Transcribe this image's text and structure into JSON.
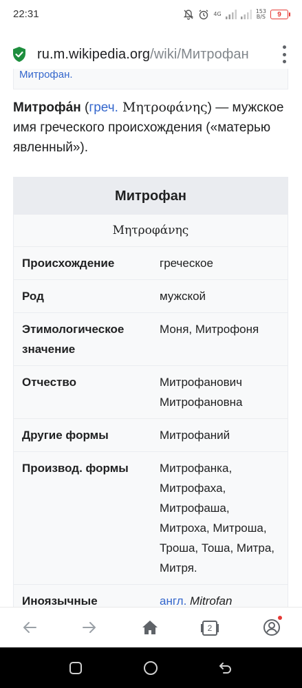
{
  "status_bar": {
    "time": "22:31",
    "network": "4G",
    "speed_value": "153",
    "speed_unit": "B/S",
    "battery": "9"
  },
  "address_bar": {
    "domain": "ru.m.wikipedia.org",
    "path": "/wiki/Митрофан",
    "lock_icon": "secure-lock-icon",
    "menu_icon": "more-vert-icon"
  },
  "article": {
    "prev_link": "Митрофан.",
    "intro": {
      "name": "Митрофа́н",
      "open_paren": " (",
      "lang_link": "греч.",
      "greek": " Μητροφάνης",
      "rest": ") — мужское имя греческого происхождения («матерью явленный»)."
    },
    "infobox": {
      "title": "Митрофан",
      "subtitle": "Μητροφάνης",
      "rows": [
        {
          "label": "Происхождение",
          "values": [
            "греческое"
          ]
        },
        {
          "label": "Род",
          "values": [
            "мужской"
          ]
        },
        {
          "label": "Этимологическое значение",
          "values": [
            "Моня, Митрофоня"
          ]
        },
        {
          "label": "Отчество",
          "values": [
            "Митрофанович",
            "Митрофановна"
          ]
        },
        {
          "label": "Другие формы",
          "values": [
            "Митрофаний"
          ]
        },
        {
          "label": "Производ. формы",
          "values": [
            "Митрофанка, Митрофаха, Митрофаша, Митроха, Митроша, Троша, Тоша, Митра, Митря."
          ]
        },
        {
          "label": "Иноязычные",
          "link": "англ.",
          "italic": "Mitrofan"
        }
      ]
    }
  },
  "bottom_nav": {
    "tab_count": "2",
    "icons": [
      "back-arrow-icon",
      "forward-arrow-icon",
      "home-icon",
      "tabs-icon",
      "account-icon"
    ]
  },
  "system_nav": {
    "icons": [
      "recent-apps-icon",
      "home-circle-icon",
      "back-icon"
    ]
  },
  "colors": {
    "link": "#3366cc",
    "infobox_header": "#eaecf0",
    "infobox_bg": "#f8f9fa",
    "secure_green": "#1e8e3e",
    "battery_red": "#e53935"
  }
}
